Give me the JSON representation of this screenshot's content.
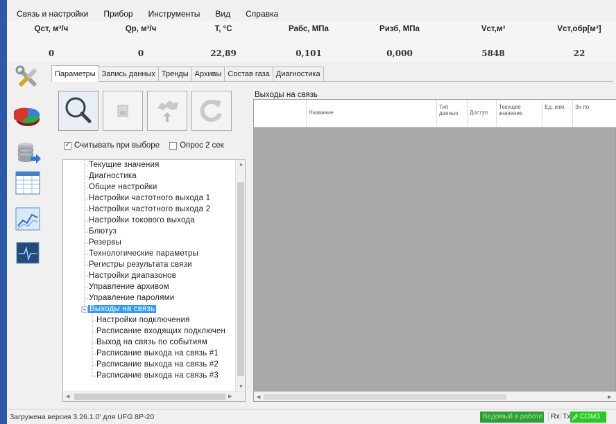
{
  "menu": [
    "Связь и настройки",
    "Прибор",
    "Инструменты",
    "Вид",
    "Справка"
  ],
  "readings": [
    {
      "label": "Qст, м³/ч",
      "value": "0"
    },
    {
      "label": "Qр, м³/ч",
      "value": "0"
    },
    {
      "label": "T, °C",
      "value": "22,89"
    },
    {
      "label": "Рабс, МПа",
      "value": "0,101"
    },
    {
      "label": "Ризб, МПа",
      "value": "0,000"
    },
    {
      "label": "Vст,м³",
      "value": "5848"
    },
    {
      "label": "Vст,обр[м³]",
      "value": "22"
    }
  ],
  "sidebar_icons": [
    "tools-icon",
    "pie-chart-icon",
    "database-icon",
    "table-icon",
    "trend-chart-icon",
    "monitor-icon"
  ],
  "tabs": [
    "Параметры",
    "Запись данных",
    "Тренды",
    "Архивы",
    "Состав газа",
    "Диагностика"
  ],
  "toolbar": [
    "search-icon",
    "save-icon",
    "upload-icon",
    "refresh-icon"
  ],
  "options": {
    "read_on_select": "Считывать при выборе",
    "read_on_select_checked": true,
    "poll_2s": "Опрос 2 сек",
    "poll_2s_checked": false
  },
  "tree": {
    "items": [
      "Текущие значения",
      "Диагностика",
      "Общие настройки",
      "Настройки частотного выхода 1",
      "Настройки частотного выхода 2",
      "Настройки токового выхода",
      "Блютуз",
      "Резервы",
      "Технологические параметры",
      "Регистры результата связи",
      "Настройки диапазонов",
      "Управление архивом",
      "Управление паролями",
      "Выходы на связь",
      "Настройки подключения",
      "Расписание входящих подключен",
      "Выход на связь по событиям",
      "Расписание выхода на связь #1",
      "Расписание выхода на связь #2",
      "Расписание выхода на связь #3"
    ],
    "selected": "Выходы на связь"
  },
  "panel": {
    "title": "Выходы на связь",
    "columns": [
      "",
      "Название",
      "Тип данных",
      "Доступ",
      "Текущее значение",
      "Ед. изм.",
      "Зн по"
    ]
  },
  "status": {
    "text": "Загружена версия 3.26.1.0' для UFG 8P-20",
    "slave": "Ведомый в работе",
    "rx": "Rx",
    "tx": "Tx",
    "port": "COM3"
  },
  "colors": {
    "selection": "#3399ff",
    "status_green": "#2e9e34",
    "com_green": "#28c828",
    "grid_bg": "#a9a9a9"
  }
}
